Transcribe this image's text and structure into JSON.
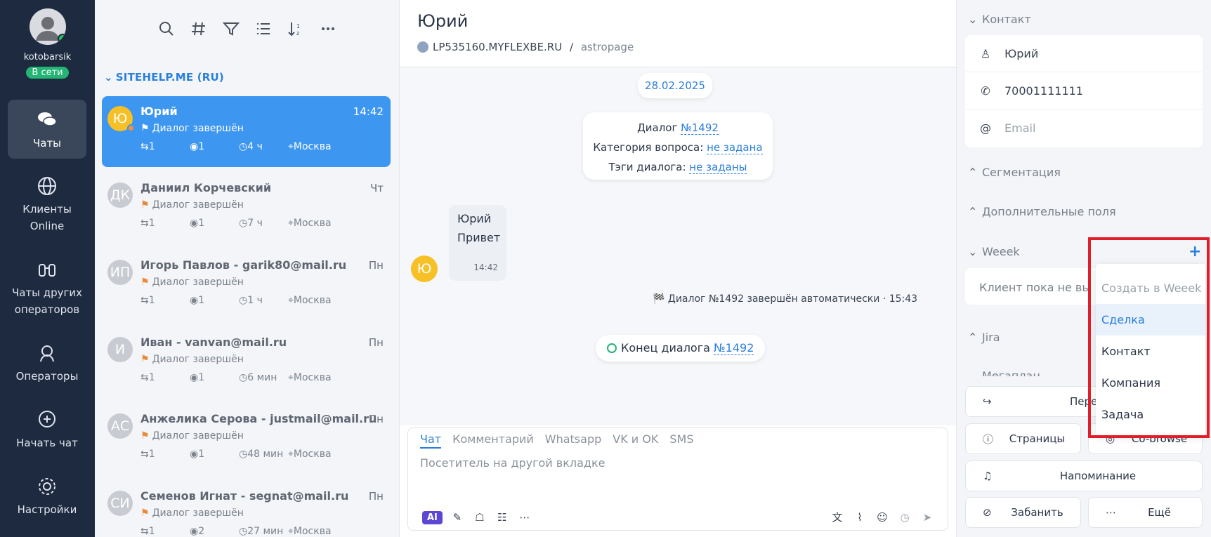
{
  "nav": {
    "user": {
      "name": "kotobarsik",
      "status": "В сети"
    },
    "items": [
      {
        "label": "Чаты",
        "icon": "chats-icon"
      },
      {
        "label": "Клиенты Online",
        "icon": "globe-icon"
      },
      {
        "label": "Чаты других операторов",
        "icon": "binoculars-icon"
      },
      {
        "label": "Операторы",
        "icon": "operator-icon"
      },
      {
        "label": "Начать чат",
        "icon": "start-chat-icon"
      },
      {
        "label": "Настройки",
        "icon": "gear-icon"
      }
    ]
  },
  "list": {
    "toolbar": [
      "search-icon",
      "hash-icon",
      "filter-icon",
      "list-icon",
      "sort-icon",
      "more-icon"
    ],
    "group": "SITEHELP.ME (RU)",
    "chats": [
      {
        "initials": "Ю",
        "name": "Юрий",
        "time": "14:42",
        "status": "Диалог завершён",
        "replies": "1",
        "views": "1",
        "duration": "4 ч",
        "city": "Москва"
      },
      {
        "initials": "ДК",
        "name": "Даниил Корчевский",
        "time": "Чт",
        "status": "Диалог завершён",
        "replies": "1",
        "views": "1",
        "duration": "7 ч",
        "city": "Москва"
      },
      {
        "initials": "ИП",
        "name": "Игорь Павлов - garik80@mail.ru",
        "time": "Пн",
        "status": "Диалог завершён",
        "replies": "1",
        "views": "1",
        "duration": "1 ч",
        "city": "Москва"
      },
      {
        "initials": "И",
        "name": "Иван - vanvan@mail.ru",
        "time": "Пн",
        "status": "Диалог завершён",
        "replies": "1",
        "views": "1",
        "duration": "6 мин",
        "city": "Москва"
      },
      {
        "initials": "АС",
        "name": "Анжелика Серова - justmail@mail.ru",
        "time": "Пн",
        "status": "Диалог завершён",
        "replies": "1",
        "views": "1",
        "duration": "48 мин",
        "city": "Москва"
      },
      {
        "initials": "СИ",
        "name": "Семенов Игнат - segnat@mail.ru",
        "time": "Пн",
        "status": "Диалог завершён",
        "replies": "1",
        "views": "2",
        "duration": "27 мин",
        "city": "Москва"
      }
    ]
  },
  "chat": {
    "title": "Юрий",
    "site": "LP535160.MYFLEXBE.RU",
    "site_sep": " / ",
    "page": "astropage",
    "date": "28.02.2025",
    "dialog_label": "Диалог",
    "dialog_no": "№1492",
    "category_label": "Категория вопроса:",
    "category_value": "не задана",
    "tags_label": "Тэги диалога:",
    "tags_value": "не заданы",
    "msg_author": "Юрий",
    "msg_text": "Привет",
    "msg_time": "14:42",
    "avatar_initial": "Ю",
    "system": "🏁 Диалог №1492 завершён автоматически · 15:43",
    "end_label": "Конец диалога",
    "end_no": "№1492"
  },
  "composer": {
    "tabs": [
      "Чат",
      "Комментарий",
      "Whatsapp",
      "VK и OK",
      "SMS"
    ],
    "placeholder": "Посетитель на другой вкладке",
    "ai_label": "AI"
  },
  "panel": {
    "contact_title": "Контакт",
    "contact_name": "Юрий",
    "contact_phone": "70001111111",
    "contact_email_placeholder": "Email",
    "segmentation": "Сегментация",
    "extra_fields": "Дополнительные поля",
    "weeek": "Weeek",
    "weeek_note": "Клиент пока не вы",
    "jira": "Jira",
    "megaplan": "Мегаплан",
    "btn_transfer": "Перек",
    "btn_pages": "Страницы",
    "btn_cobrowse": "Co-browse",
    "btn_reminder": "Напоминание",
    "btn_ban": "Забанить",
    "btn_more": "Ещё"
  },
  "dropdown": {
    "header": "Создать в Weeek",
    "items": [
      "Сделка",
      "Контакт",
      "Компания",
      "Задача"
    ]
  },
  "colors": {
    "accent": "#2a7fdb",
    "active_item": "#3d96f0",
    "nav_bg": "#1e2a3f",
    "highlight_box": "#e11d2a",
    "online": "#22b573"
  }
}
